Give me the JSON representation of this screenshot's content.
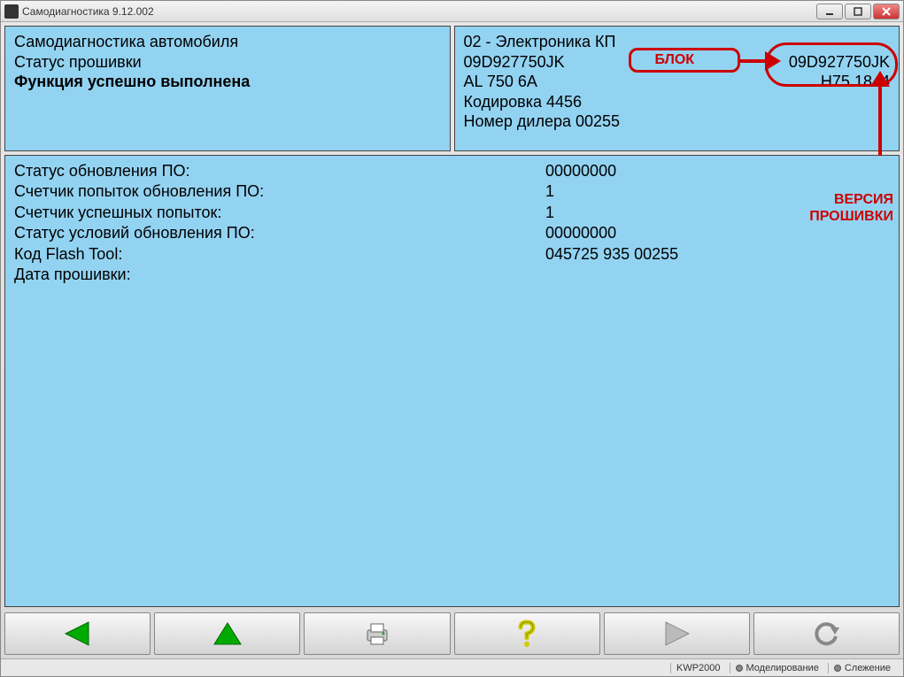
{
  "window": {
    "title": "Самодиагностика 9.12.002"
  },
  "left_panel": {
    "line1": "Самодиагностика автомобиля",
    "line2": "Статус прошивки",
    "line3": "Функция успешно выполнена"
  },
  "right_panel": {
    "module": "02 - Электроника КП",
    "partnum_label": "09D927750JK",
    "partnum_value": "09D927750JK",
    "component_label": "AL 750 6A",
    "component_value": "H75  1844",
    "coding": "Кодировка 4456",
    "dealer": "Номер дилера 00255"
  },
  "annotations": {
    "block": "БЛОК",
    "firmware_version": "ВЕРСИЯ ПРОШИВКИ"
  },
  "data": [
    {
      "label": "Статус обновления ПО:",
      "value": "00000000"
    },
    {
      "label": "Счетчик попыток обновления ПО:",
      "value": "1"
    },
    {
      "label": "Счетчик успешных попыток:",
      "value": "1"
    },
    {
      "label": "Статус условий обновления ПО:",
      "value": "00000000"
    },
    {
      "label": "Код Flash Tool:",
      "value": "045725 935 00255"
    },
    {
      "label": "Дата прошивки:",
      "value": ""
    }
  ],
  "statusbar": {
    "protocol": "KWP2000",
    "mode1": "Моделирование",
    "mode2": "Слежение"
  }
}
